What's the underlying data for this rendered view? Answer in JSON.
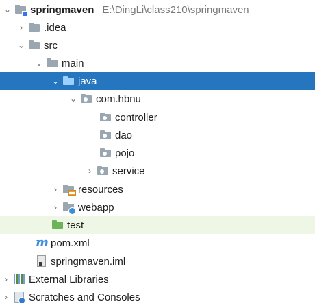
{
  "project": {
    "name": "springmaven",
    "path": "E:\\DingLi\\class210\\springmaven"
  },
  "tree": {
    "idea": ".idea",
    "src": "src",
    "main": "main",
    "java": "java",
    "package": "com.hbnu",
    "controller": "controller",
    "dao": "dao",
    "pojo": "pojo",
    "service": "service",
    "resources": "resources",
    "webapp": "webapp",
    "test": "test",
    "pom": "pom.xml",
    "iml": "springmaven.iml",
    "external_libraries": "External Libraries",
    "scratches": "Scratches and Consoles"
  },
  "icons": {
    "collapsed": "chevron-right-icon",
    "expanded": "chevron-down-icon"
  },
  "colors": {
    "selection": "#2675bf",
    "test_highlight": "#eef6e6",
    "path": "#7a7a7a"
  }
}
